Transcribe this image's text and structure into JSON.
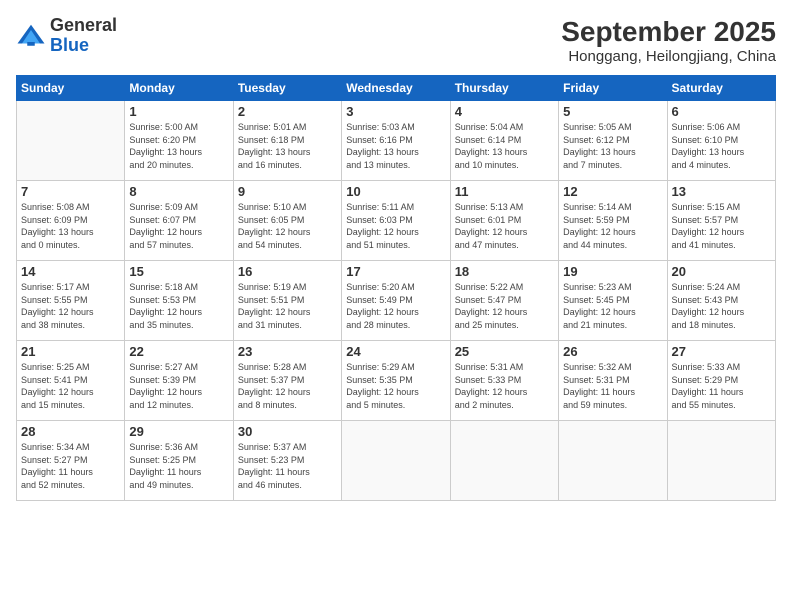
{
  "logo": {
    "line1": "General",
    "line2": "Blue"
  },
  "title": "September 2025",
  "subtitle": "Honggang, Heilongjiang, China",
  "days_header": [
    "Sunday",
    "Monday",
    "Tuesday",
    "Wednesday",
    "Thursday",
    "Friday",
    "Saturday"
  ],
  "weeks": [
    [
      {
        "day": "",
        "info": ""
      },
      {
        "day": "1",
        "info": "Sunrise: 5:00 AM\nSunset: 6:20 PM\nDaylight: 13 hours\nand 20 minutes."
      },
      {
        "day": "2",
        "info": "Sunrise: 5:01 AM\nSunset: 6:18 PM\nDaylight: 13 hours\nand 16 minutes."
      },
      {
        "day": "3",
        "info": "Sunrise: 5:03 AM\nSunset: 6:16 PM\nDaylight: 13 hours\nand 13 minutes."
      },
      {
        "day": "4",
        "info": "Sunrise: 5:04 AM\nSunset: 6:14 PM\nDaylight: 13 hours\nand 10 minutes."
      },
      {
        "day": "5",
        "info": "Sunrise: 5:05 AM\nSunset: 6:12 PM\nDaylight: 13 hours\nand 7 minutes."
      },
      {
        "day": "6",
        "info": "Sunrise: 5:06 AM\nSunset: 6:10 PM\nDaylight: 13 hours\nand 4 minutes."
      }
    ],
    [
      {
        "day": "7",
        "info": "Sunrise: 5:08 AM\nSunset: 6:09 PM\nDaylight: 13 hours\nand 0 minutes."
      },
      {
        "day": "8",
        "info": "Sunrise: 5:09 AM\nSunset: 6:07 PM\nDaylight: 12 hours\nand 57 minutes."
      },
      {
        "day": "9",
        "info": "Sunrise: 5:10 AM\nSunset: 6:05 PM\nDaylight: 12 hours\nand 54 minutes."
      },
      {
        "day": "10",
        "info": "Sunrise: 5:11 AM\nSunset: 6:03 PM\nDaylight: 12 hours\nand 51 minutes."
      },
      {
        "day": "11",
        "info": "Sunrise: 5:13 AM\nSunset: 6:01 PM\nDaylight: 12 hours\nand 47 minutes."
      },
      {
        "day": "12",
        "info": "Sunrise: 5:14 AM\nSunset: 5:59 PM\nDaylight: 12 hours\nand 44 minutes."
      },
      {
        "day": "13",
        "info": "Sunrise: 5:15 AM\nSunset: 5:57 PM\nDaylight: 12 hours\nand 41 minutes."
      }
    ],
    [
      {
        "day": "14",
        "info": "Sunrise: 5:17 AM\nSunset: 5:55 PM\nDaylight: 12 hours\nand 38 minutes."
      },
      {
        "day": "15",
        "info": "Sunrise: 5:18 AM\nSunset: 5:53 PM\nDaylight: 12 hours\nand 35 minutes."
      },
      {
        "day": "16",
        "info": "Sunrise: 5:19 AM\nSunset: 5:51 PM\nDaylight: 12 hours\nand 31 minutes."
      },
      {
        "day": "17",
        "info": "Sunrise: 5:20 AM\nSunset: 5:49 PM\nDaylight: 12 hours\nand 28 minutes."
      },
      {
        "day": "18",
        "info": "Sunrise: 5:22 AM\nSunset: 5:47 PM\nDaylight: 12 hours\nand 25 minutes."
      },
      {
        "day": "19",
        "info": "Sunrise: 5:23 AM\nSunset: 5:45 PM\nDaylight: 12 hours\nand 21 minutes."
      },
      {
        "day": "20",
        "info": "Sunrise: 5:24 AM\nSunset: 5:43 PM\nDaylight: 12 hours\nand 18 minutes."
      }
    ],
    [
      {
        "day": "21",
        "info": "Sunrise: 5:25 AM\nSunset: 5:41 PM\nDaylight: 12 hours\nand 15 minutes."
      },
      {
        "day": "22",
        "info": "Sunrise: 5:27 AM\nSunset: 5:39 PM\nDaylight: 12 hours\nand 12 minutes."
      },
      {
        "day": "23",
        "info": "Sunrise: 5:28 AM\nSunset: 5:37 PM\nDaylight: 12 hours\nand 8 minutes."
      },
      {
        "day": "24",
        "info": "Sunrise: 5:29 AM\nSunset: 5:35 PM\nDaylight: 12 hours\nand 5 minutes."
      },
      {
        "day": "25",
        "info": "Sunrise: 5:31 AM\nSunset: 5:33 PM\nDaylight: 12 hours\nand 2 minutes."
      },
      {
        "day": "26",
        "info": "Sunrise: 5:32 AM\nSunset: 5:31 PM\nDaylight: 11 hours\nand 59 minutes."
      },
      {
        "day": "27",
        "info": "Sunrise: 5:33 AM\nSunset: 5:29 PM\nDaylight: 11 hours\nand 55 minutes."
      }
    ],
    [
      {
        "day": "28",
        "info": "Sunrise: 5:34 AM\nSunset: 5:27 PM\nDaylight: 11 hours\nand 52 minutes."
      },
      {
        "day": "29",
        "info": "Sunrise: 5:36 AM\nSunset: 5:25 PM\nDaylight: 11 hours\nand 49 minutes."
      },
      {
        "day": "30",
        "info": "Sunrise: 5:37 AM\nSunset: 5:23 PM\nDaylight: 11 hours\nand 46 minutes."
      },
      {
        "day": "",
        "info": ""
      },
      {
        "day": "",
        "info": ""
      },
      {
        "day": "",
        "info": ""
      },
      {
        "day": "",
        "info": ""
      }
    ]
  ]
}
